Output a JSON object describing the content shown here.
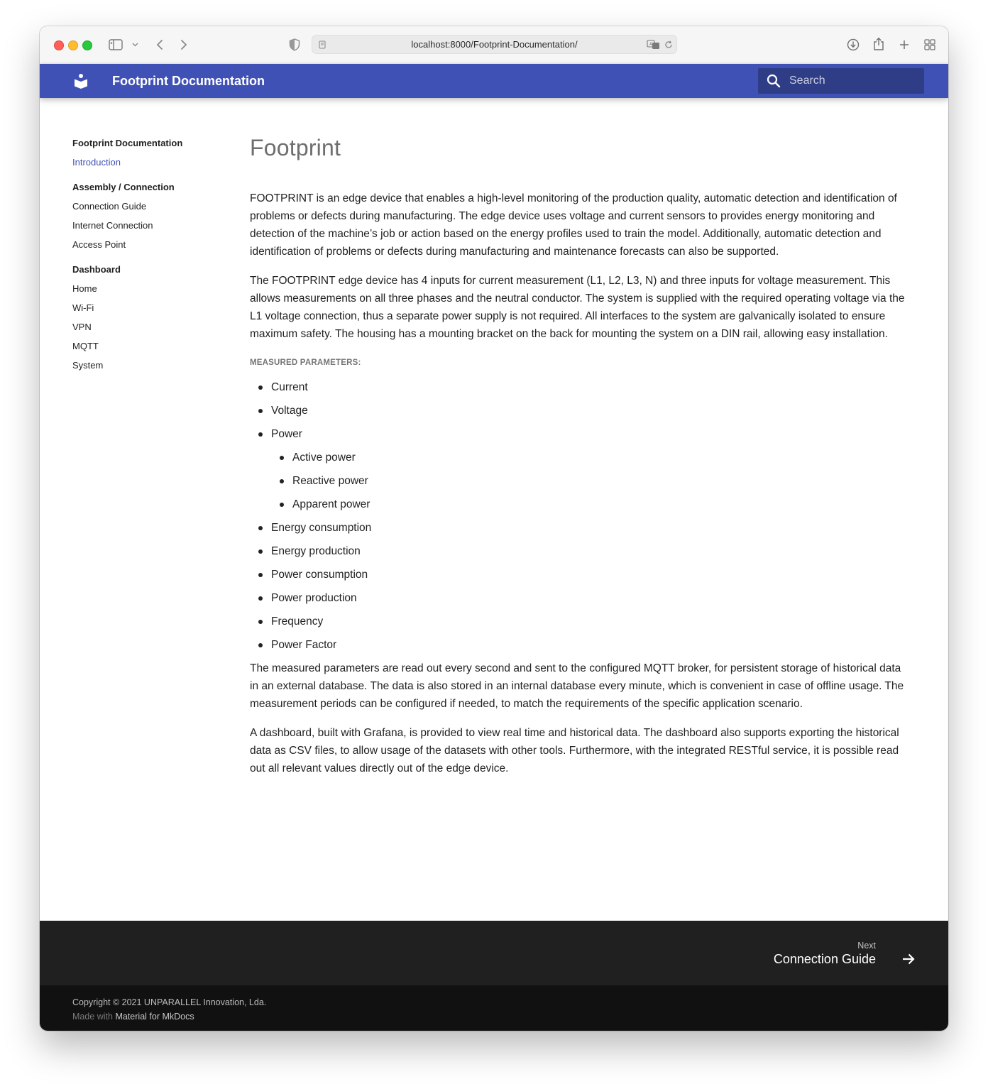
{
  "browser": {
    "url": "localhost:8000/Footprint-Documentation/"
  },
  "header": {
    "site_title": "Footprint Documentation",
    "search_placeholder": "Search"
  },
  "sidebar": {
    "sections": [
      {
        "title": "Footprint Documentation",
        "items": [
          "Introduction"
        ]
      },
      {
        "title": "Assembly / Connection",
        "items": [
          "Connection Guide",
          "Internet Connection",
          "Access Point"
        ]
      },
      {
        "title": "Dashboard",
        "items": [
          "Home",
          "Wi-Fi",
          "VPN",
          "MQTT",
          "System"
        ]
      }
    ],
    "active_item": "Introduction"
  },
  "content": {
    "title": "Footprint",
    "paragraph1": "FOOTPRINT is an edge device that enables a high-level monitoring of the production quality, automatic detection and identification of problems or defects during manufacturing. The edge device uses voltage and current sensors to provides energy monitoring and detection of the machine’s job or action based on the energy profiles used to train the model. Additionally, automatic detection and identification of problems or defects during manufacturing and maintenance forecasts can also be supported.",
    "paragraph2": "The FOOTPRINT edge device has 4 inputs for current measurement (L1, L2, L3, N) and three inputs for voltage measurement. This allows measurements on all three phases and the neutral conductor. The system is supplied with the required operating voltage via the L1 voltage connection, thus a separate power supply is not required. All interfaces to the system are galvanically isolated to ensure maximum safety. The housing has a mounting bracket on the back for mounting the system on a DIN rail, allowing easy installation.",
    "subheading": "MEASURED PARAMETERS:",
    "parameters": [
      {
        "label": "Current",
        "level": 1
      },
      {
        "label": "Voltage",
        "level": 1
      },
      {
        "label": "Power",
        "level": 1
      },
      {
        "label": "Active power",
        "level": 2
      },
      {
        "label": "Reactive power",
        "level": 2
      },
      {
        "label": "Apparent power",
        "level": 2
      },
      {
        "label": "Energy consumption",
        "level": 1
      },
      {
        "label": "Energy production",
        "level": 1
      },
      {
        "label": "Power consumption",
        "level": 1
      },
      {
        "label": "Power production",
        "level": 1
      },
      {
        "label": "Frequency",
        "level": 1
      },
      {
        "label": "Power Factor",
        "level": 1
      }
    ],
    "paragraph3": "The measured parameters are read out every second and sent to the configured MQTT broker, for persistent storage of historical data in an external database. The data is also stored in an internal database every minute, which is convenient in case of offline usage. The measurement periods can be configured if needed, to match the requirements of the specific application scenario.",
    "paragraph4": "A dashboard, built with Grafana, is provided to view real time and historical data. The dashboard also supports exporting the historical data as CSV files, to allow usage of the datasets with other tools. Furthermore, with the integrated RESTful service, it is possible read out all relevant values directly out of the edge device."
  },
  "footer": {
    "next_caption": "Next",
    "next_title": "Connection Guide",
    "copyright": "Copyright © 2021 UNPARALLEL Innovation, Lda.",
    "made_with_prefix": "Made with",
    "made_with_link": "Material for MkDocs"
  },
  "colors": {
    "primary": "#4051b5",
    "footer_nav": "#202020",
    "footer_meta": "#111111"
  }
}
